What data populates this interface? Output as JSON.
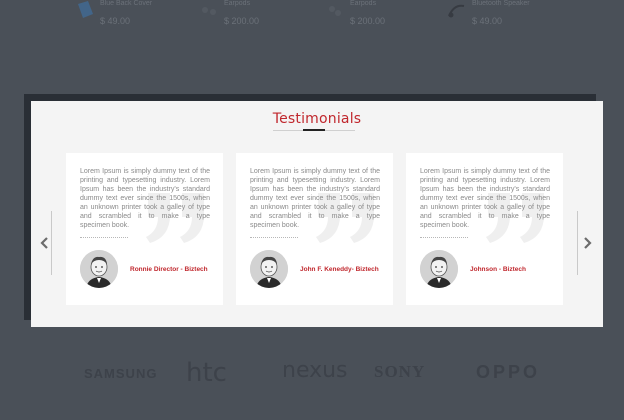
{
  "products": [
    {
      "name": "Blue Back Cover",
      "price": "$ 49.00",
      "icon": "phone-case-icon"
    },
    {
      "name": "Earpods",
      "price": "$ 200.00",
      "icon": "earphones-icon"
    },
    {
      "name": "Earpods",
      "price": "$ 200.00",
      "icon": "earphones-icon"
    },
    {
      "name": "Bluetooth Speaker",
      "price": "$ 49.00",
      "icon": "speaker-icon"
    }
  ],
  "brands": [
    "SAMSUNG",
    "htc",
    "nexus",
    "SONY",
    "OPPO"
  ],
  "testimonials": {
    "title": "Testimonials",
    "items": [
      {
        "text": "Lorem Ipsum is simply dummy text of the printing and typesetting industry. Lorem Ipsum has been the industry's standard dummy text ever since the 1500s, when an unknown printer took a galley of type and scrambled it to make a type specimen book.",
        "author": "Ronnie Director - Biztech"
      },
      {
        "text": "Lorem Ipsum is simply dummy text of the printing and typesetting industry. Lorem Ipsum has been the industry's standard dummy text ever since the 1500s, when an unknown printer took a galley of type and scrambled it to make a type specimen book.",
        "author": "John F. Keneddy- Biztech"
      },
      {
        "text": "Lorem Ipsum is simply dummy text of the printing and typesetting industry. Lorem Ipsum has been the industry's standard dummy text ever since the 1500s, when an unknown printer took a galley of type and scrambled it to make a type specimen book.",
        "author": "Johnson - Biztech"
      }
    ],
    "prev_icon": "chevron-left-icon",
    "next_icon": "chevron-right-icon"
  },
  "colors": {
    "accent": "#c0272d",
    "backdrop": "#4a5058",
    "modal": "#f4f4f4",
    "card": "#ffffff"
  }
}
